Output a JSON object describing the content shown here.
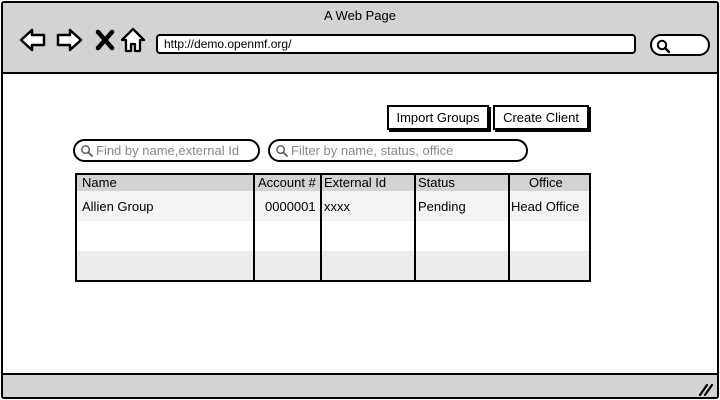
{
  "window": {
    "title": "A Web Page"
  },
  "browser": {
    "url": "http://demo.openmf.org/",
    "icons": [
      "back-arrow-icon",
      "forward-arrow-icon",
      "close-x-icon",
      "home-icon",
      "search-icon"
    ]
  },
  "toolbar": {
    "import_groups_label": "Import Groups",
    "create_client_label": "Create Client"
  },
  "search": {
    "name_placeholder": "Find by name,external Id",
    "filter_placeholder": "Filter by name, status, office"
  },
  "table": {
    "columns": [
      "Name",
      "Account #",
      "External Id",
      "Status",
      "Office"
    ],
    "rows": [
      {
        "name": "Allien Group",
        "account": "0000001",
        "external_id": "xxxx",
        "status": "Pending",
        "office": "Head Office"
      }
    ]
  }
}
